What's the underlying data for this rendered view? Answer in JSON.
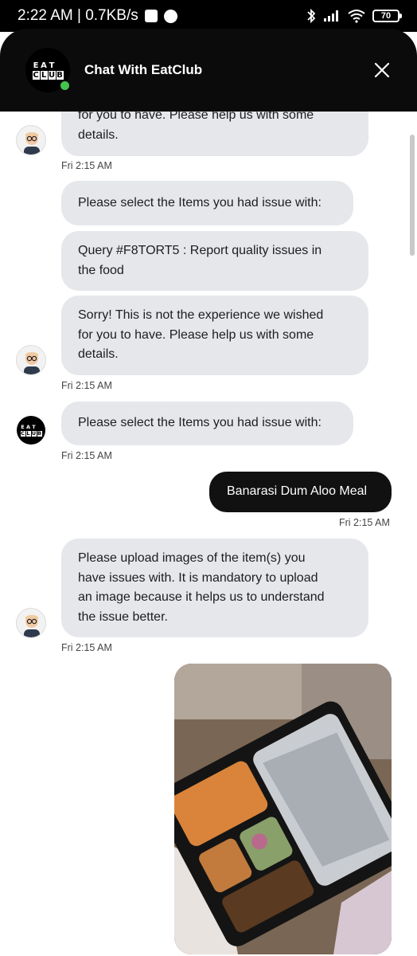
{
  "status_bar": {
    "time_speed": "2:22 AM | 0.7KB/s",
    "battery": "70"
  },
  "header": {
    "logo_letters": [
      "E",
      "A",
      "T",
      "",
      "C",
      "L",
      "U",
      "B"
    ],
    "title": "Chat With EatClub",
    "online_color": "#46c44e"
  },
  "messages": [
    {
      "sender": "bot",
      "lines": [
        "for you to have. Please help us with some",
        "details."
      ]
    },
    {
      "sender": "meta",
      "time": "Fri 2:15 AM"
    },
    {
      "sender": "bot",
      "lines": [
        "Please select the Items you had issue with:"
      ]
    },
    {
      "sender": "bot",
      "lines": [
        "Query #F8TORT5 : Report quality issues in",
        "the food"
      ]
    },
    {
      "sender": "bot",
      "lines": [
        "Sorry! This is not the experience we wished",
        "for you to have. Please help us with some",
        "details."
      ]
    },
    {
      "sender": "meta",
      "time": "Fri 2:15 AM"
    },
    {
      "sender": "bot",
      "lines": [
        "Please select the Items you had issue with:"
      ]
    },
    {
      "sender": "meta",
      "time": "Fri 2:15 AM"
    },
    {
      "sender": "user",
      "lines": [
        "Banarasi Dum Aloo Meal"
      ]
    },
    {
      "sender": "meta",
      "time": "Fri 2:15 AM"
    },
    {
      "sender": "bot",
      "lines": [
        "Please upload images of the item(s) you",
        "have issues with. It is mandatory to upload",
        "an image because it helps us to understand",
        "the issue better."
      ]
    },
    {
      "sender": "meta",
      "time": "Fri 2:15 AM"
    }
  ],
  "icons": {
    "close": "close-icon",
    "bot_avatar": "bot-avatar-icon",
    "user_photo": "food-photo"
  }
}
